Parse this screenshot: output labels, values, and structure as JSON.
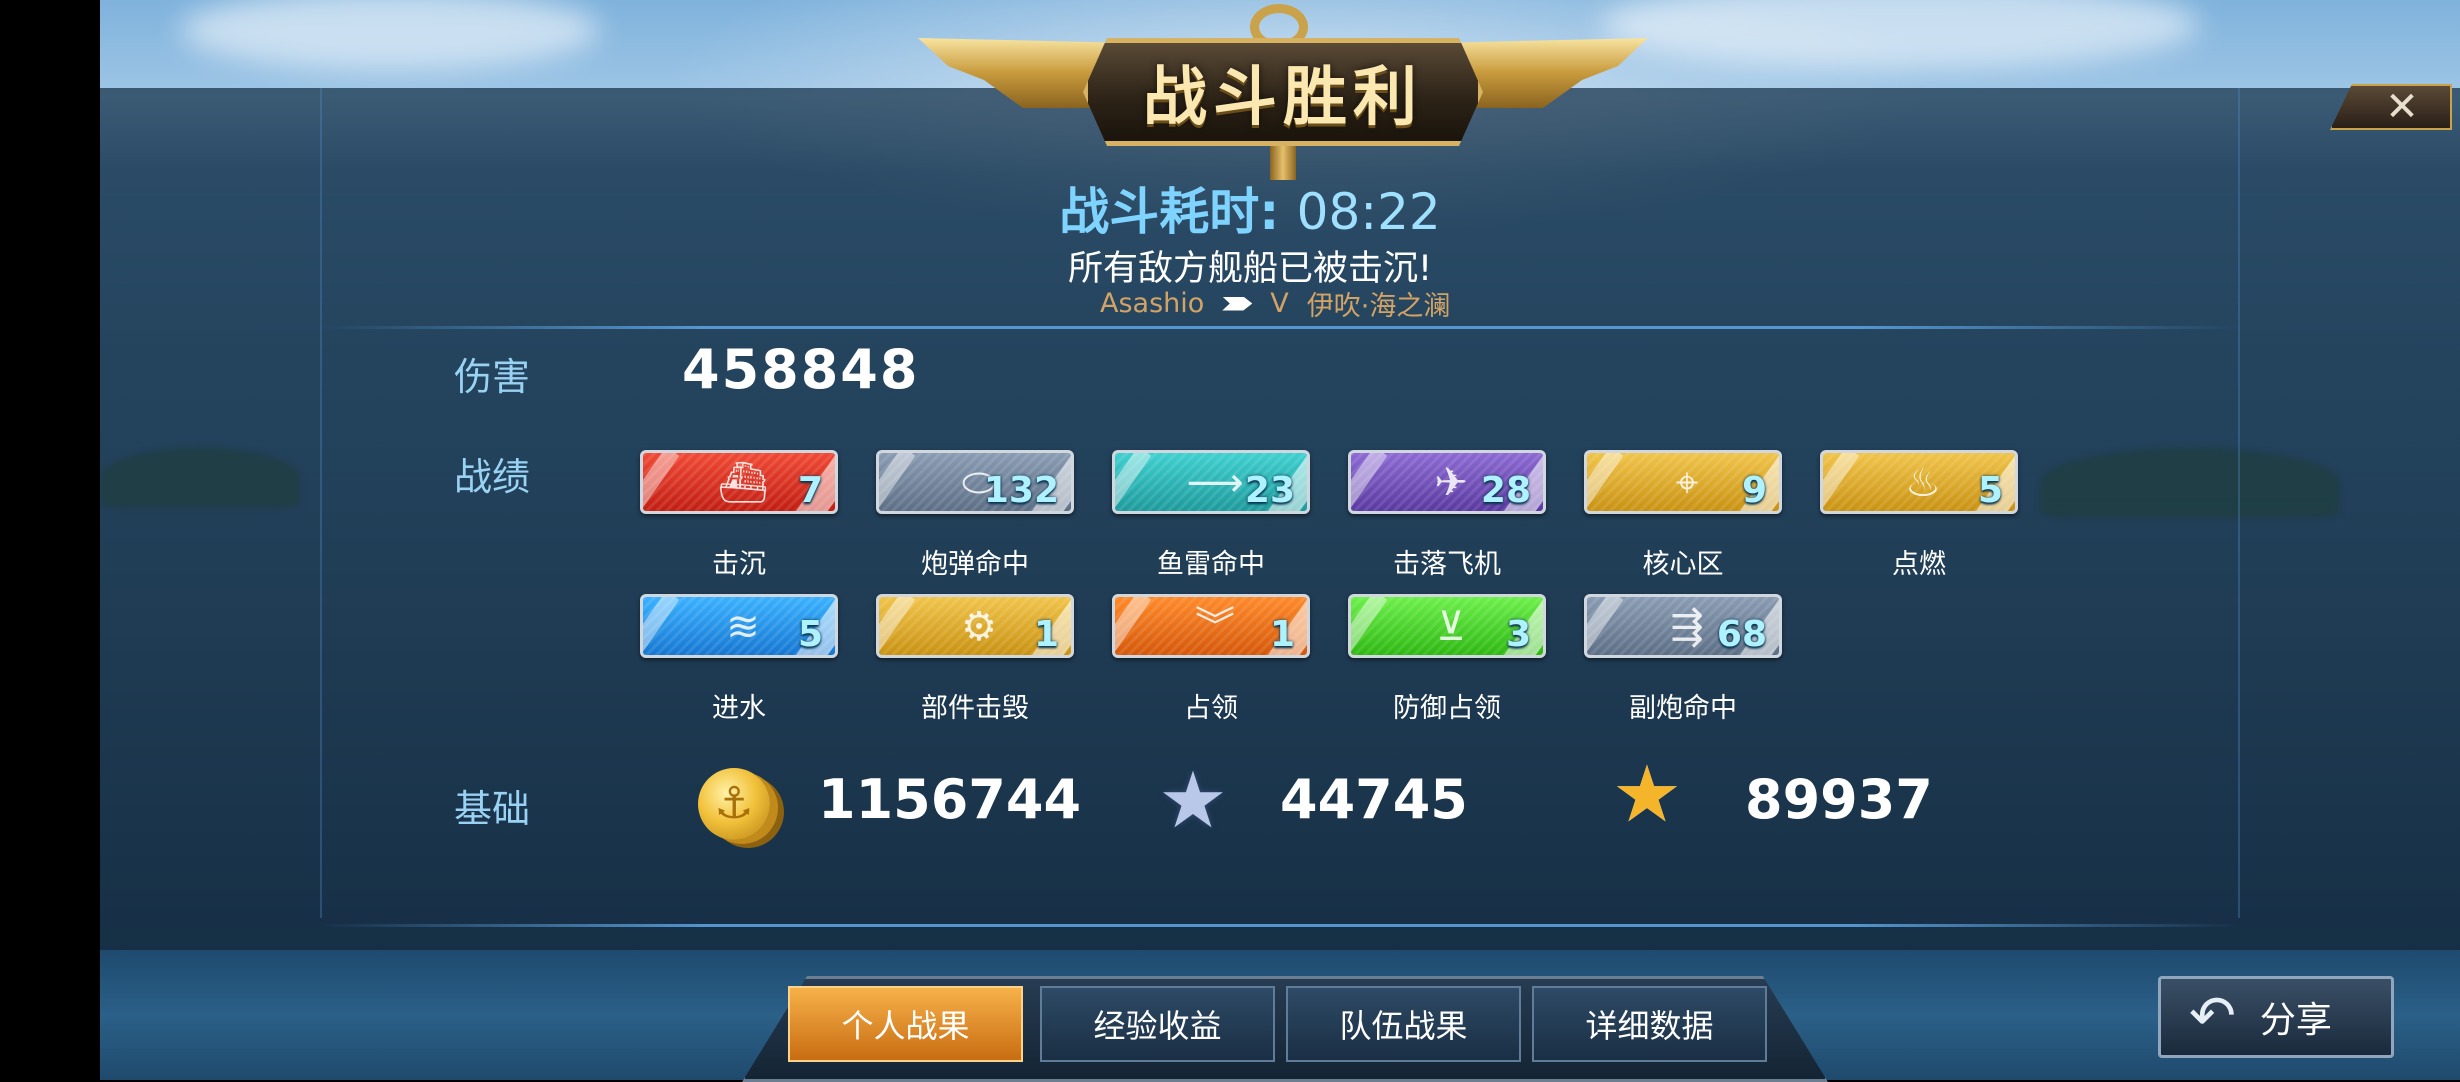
{
  "banner": {
    "title": "战斗胜利"
  },
  "close_icon": "✕",
  "battle": {
    "time_label": "战斗耗时:",
    "time_value": "08:22",
    "result": "所有敌方舰船已被击沉!",
    "player": "Asashio",
    "rank": "V",
    "ship": "伊吹·海之澜"
  },
  "damage": {
    "label": "伤害",
    "value": "458848"
  },
  "record": {
    "label": "战绩",
    "badges": [
      {
        "label": "击沉",
        "count": "7",
        "icon": "sunk-ship-icon",
        "color": "red"
      },
      {
        "label": "炮弹命中",
        "count": "132",
        "icon": "shell-hit-icon",
        "color": "slate"
      },
      {
        "label": "鱼雷命中",
        "count": "23",
        "icon": "torpedo-hit-icon",
        "color": "teal"
      },
      {
        "label": "击落飞机",
        "count": "28",
        "icon": "plane-shot-icon",
        "color": "purple"
      },
      {
        "label": "核心区",
        "count": "9",
        "icon": "citadel-icon",
        "color": "gold"
      },
      {
        "label": "点燃",
        "count": "5",
        "icon": "fire-icon",
        "color": "gold"
      },
      {
        "label": "进水",
        "count": "5",
        "icon": "flooding-icon",
        "color": "blue"
      },
      {
        "label": "部件击毁",
        "count": "1",
        "icon": "module-destroyed-icon",
        "color": "gold"
      },
      {
        "label": "占领",
        "count": "1",
        "icon": "capture-icon",
        "color": "orange"
      },
      {
        "label": "防御占领",
        "count": "3",
        "icon": "defend-capture-icon",
        "color": "green"
      },
      {
        "label": "副炮命中",
        "count": "68",
        "icon": "secondary-hit-icon",
        "color": "slate"
      }
    ]
  },
  "base": {
    "label": "基础",
    "credits": "1156744",
    "xp": "44745",
    "commander_xp": "89937"
  },
  "tabs": [
    {
      "label": "个人战果",
      "active": true
    },
    {
      "label": "经验收益",
      "active": false
    },
    {
      "label": "队伍战果",
      "active": false
    },
    {
      "label": "详细数据",
      "active": false
    }
  ],
  "share": {
    "label": "分享"
  }
}
